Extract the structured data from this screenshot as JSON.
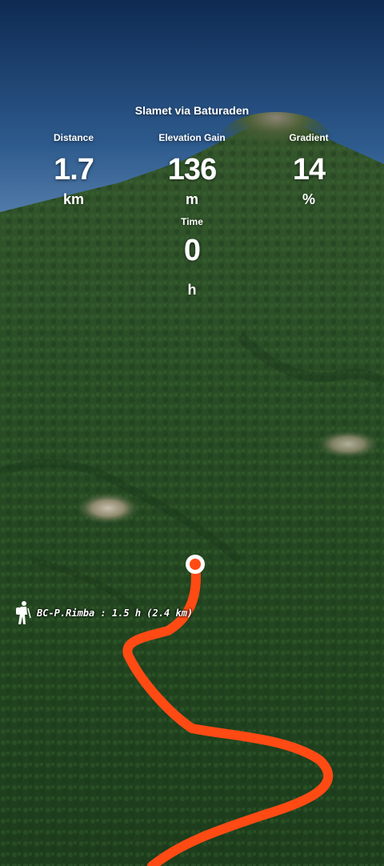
{
  "route": {
    "title": "Slamet via Baturaden"
  },
  "stats": {
    "distance": {
      "label": "Distance",
      "value": "1.7",
      "unit": "km"
    },
    "elevation_gain": {
      "label": "Elevation Gain",
      "value": "136",
      "unit": "m"
    },
    "gradient": {
      "label": "Gradient",
      "value": "14",
      "unit": "%"
    },
    "time": {
      "label": "Time",
      "value": "0",
      "unit": "h"
    }
  },
  "waypoint": {
    "label": "BC-P.Rimba : 1.5 h (2.4 km)",
    "icon": "hiker-icon"
  },
  "colors": {
    "track": "#ff4a14",
    "marker_fill": "#ff4a14",
    "marker_ring": "#ffffff"
  }
}
